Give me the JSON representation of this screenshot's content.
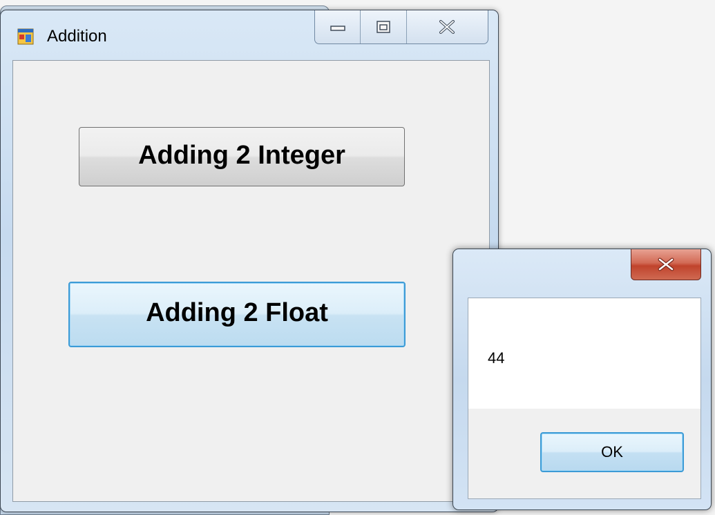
{
  "main_window": {
    "title": "Addition",
    "buttons": {
      "integer": "Adding 2 Integer",
      "float": "Adding 2 Float"
    }
  },
  "message_box": {
    "text": "44",
    "ok_label": "OK"
  },
  "icons": {
    "app": "app-form-icon",
    "minimize": "minimize-icon",
    "maximize": "maximize-icon",
    "close": "close-icon"
  },
  "colors": {
    "focus_border": "#3c9bd6",
    "close_red": "#c0432c",
    "client_bg": "#f0f0f0"
  }
}
